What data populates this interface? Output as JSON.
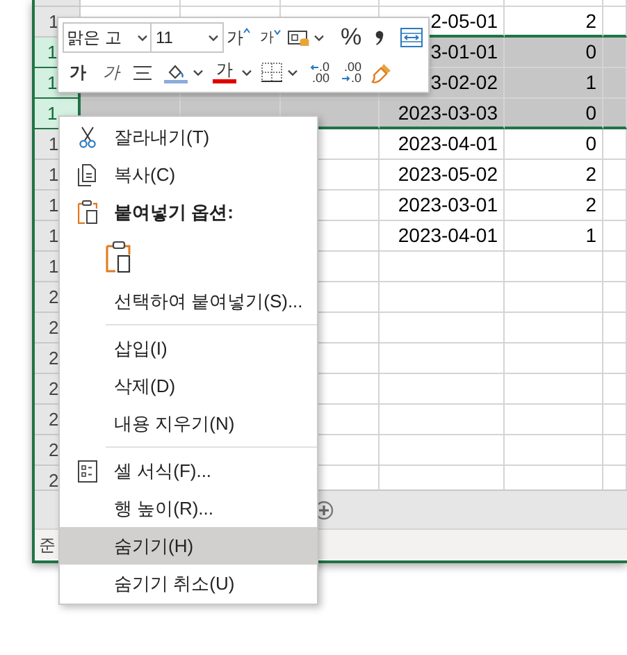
{
  "sheet": {
    "rows": [
      {
        "header": "1",
        "selected": false,
        "cells": {
          "d": "2-05-01",
          "e": "2"
        }
      },
      {
        "header": "1",
        "selected": true,
        "cells": {
          "d": "3-01-01",
          "e": "0"
        }
      },
      {
        "header": "1",
        "selected": true,
        "cells": {
          "d": "3-02-02",
          "e": "1"
        }
      },
      {
        "header": "1",
        "selected": true,
        "cells": {
          "d": "2023-03-03",
          "e": "0"
        }
      },
      {
        "header": "1",
        "selected": false,
        "cells": {
          "d": "2023-04-01",
          "e": "0"
        }
      },
      {
        "header": "1",
        "selected": false,
        "cells": {
          "d": "2023-05-02",
          "e": "2"
        }
      },
      {
        "header": "1",
        "selected": false,
        "cells": {
          "d": "2023-03-01",
          "e": "2"
        }
      },
      {
        "header": "1",
        "selected": false,
        "cells": {
          "d": "2023-04-01",
          "e": "1"
        }
      },
      {
        "header": "1",
        "selected": false,
        "cells": {}
      },
      {
        "header": "2",
        "selected": false,
        "cells": {}
      },
      {
        "header": "2",
        "selected": false,
        "cells": {}
      },
      {
        "header": "2",
        "selected": false,
        "cells": {}
      },
      {
        "header": "2",
        "selected": false,
        "cells": {}
      },
      {
        "header": "2",
        "selected": false,
        "cells": {}
      },
      {
        "header": "2",
        "selected": false,
        "cells": {}
      },
      {
        "header": "2",
        "selected": false,
        "cells": {}
      }
    ]
  },
  "status_bar": {
    "text": "준"
  },
  "mini_toolbar": {
    "font": "맑은 고",
    "size": "11",
    "row_1": [
      {
        "kind": "grow",
        "text": "가"
      },
      {
        "kind": "shrink",
        "text": "가"
      },
      {
        "kind": "accounting"
      },
      {
        "kind": "percent",
        "text": "%"
      },
      {
        "kind": "comma"
      },
      {
        "kind": "wrap"
      }
    ],
    "row_2": [
      {
        "kind": "bold",
        "text": "가"
      },
      {
        "kind": "italic",
        "text": "가"
      },
      {
        "kind": "align"
      },
      {
        "kind": "fill"
      },
      {
        "kind": "font_color",
        "text": "가"
      },
      {
        "kind": "borders"
      },
      {
        "kind": "inc_decimal",
        "top": ".0",
        "bottom": ".00"
      },
      {
        "kind": "dec_decimal",
        "top": ".00",
        "bottom": ".0"
      },
      {
        "kind": "painter"
      }
    ]
  },
  "context_menu": {
    "items": [
      {
        "kind": "cut",
        "label": "잘라내기(T)",
        "highlighted": false
      },
      {
        "kind": "copy",
        "label": "복사(C)",
        "highlighted": false
      },
      {
        "kind": "paste_header",
        "label": "붙여넣기 옵션:"
      },
      {
        "kind": "paste_option"
      },
      {
        "kind": "plain",
        "label": "선택하여 붙여넣기(S)...",
        "highlighted": false
      },
      {
        "kind": "separator"
      },
      {
        "kind": "plain",
        "label": "삽입(I)",
        "highlighted": false
      },
      {
        "kind": "plain",
        "label": "삭제(D)",
        "highlighted": false
      },
      {
        "kind": "plain",
        "label": "내용 지우기(N)",
        "highlighted": false
      },
      {
        "kind": "separator"
      },
      {
        "kind": "format_cells",
        "label": "셀 서식(F)...",
        "highlighted": false
      },
      {
        "kind": "plain",
        "label": "행 높이(R)...",
        "highlighted": false
      },
      {
        "kind": "plain",
        "label": "숨기기(H)",
        "highlighted": true
      },
      {
        "kind": "plain",
        "label": "숨기기 취소(U)",
        "highlighted": false
      }
    ]
  }
}
